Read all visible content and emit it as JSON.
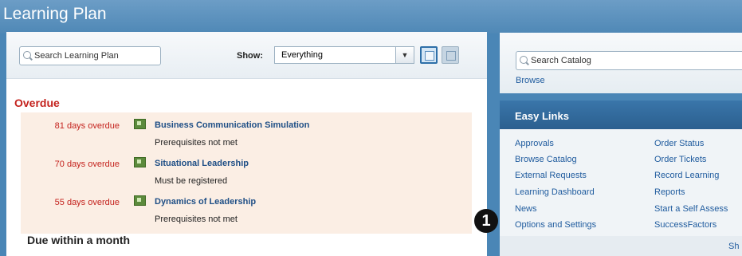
{
  "header": {
    "title": "Learning Plan"
  },
  "learning_plan": {
    "search_placeholder": "Search Learning Plan",
    "show_label": "Show:",
    "show_value": "Everything",
    "overdue_heading": "Overdue",
    "due_heading": "Due within a month",
    "items": [
      {
        "days": "81 days overdue",
        "title": "Business Communication Simulation",
        "note": "Prerequisites not met"
      },
      {
        "days": "70 days overdue",
        "title": "Situational Leadership",
        "note": "Must be registered"
      },
      {
        "days": "55 days overdue",
        "title": "Dynamics of Leadership",
        "note": "Prerequisites not met"
      }
    ]
  },
  "catalog": {
    "search_placeholder": "Search Catalog",
    "browse": "Browse"
  },
  "easy_links": {
    "title": "Easy Links",
    "col1": [
      "Approvals",
      "Browse Catalog",
      "External Requests",
      "Learning Dashboard",
      "News",
      "Options and Settings"
    ],
    "col2": [
      "Order Status",
      "Order Tickets",
      "Record Learning",
      "Reports",
      "Start a Self Assess",
      "SuccessFactors"
    ],
    "footer": "Sh"
  },
  "callout": {
    "number": "1"
  },
  "icons": [
    "search-icon",
    "dropdown-arrow-icon",
    "list-view-icon",
    "grid-view-icon",
    "course-icon"
  ]
}
